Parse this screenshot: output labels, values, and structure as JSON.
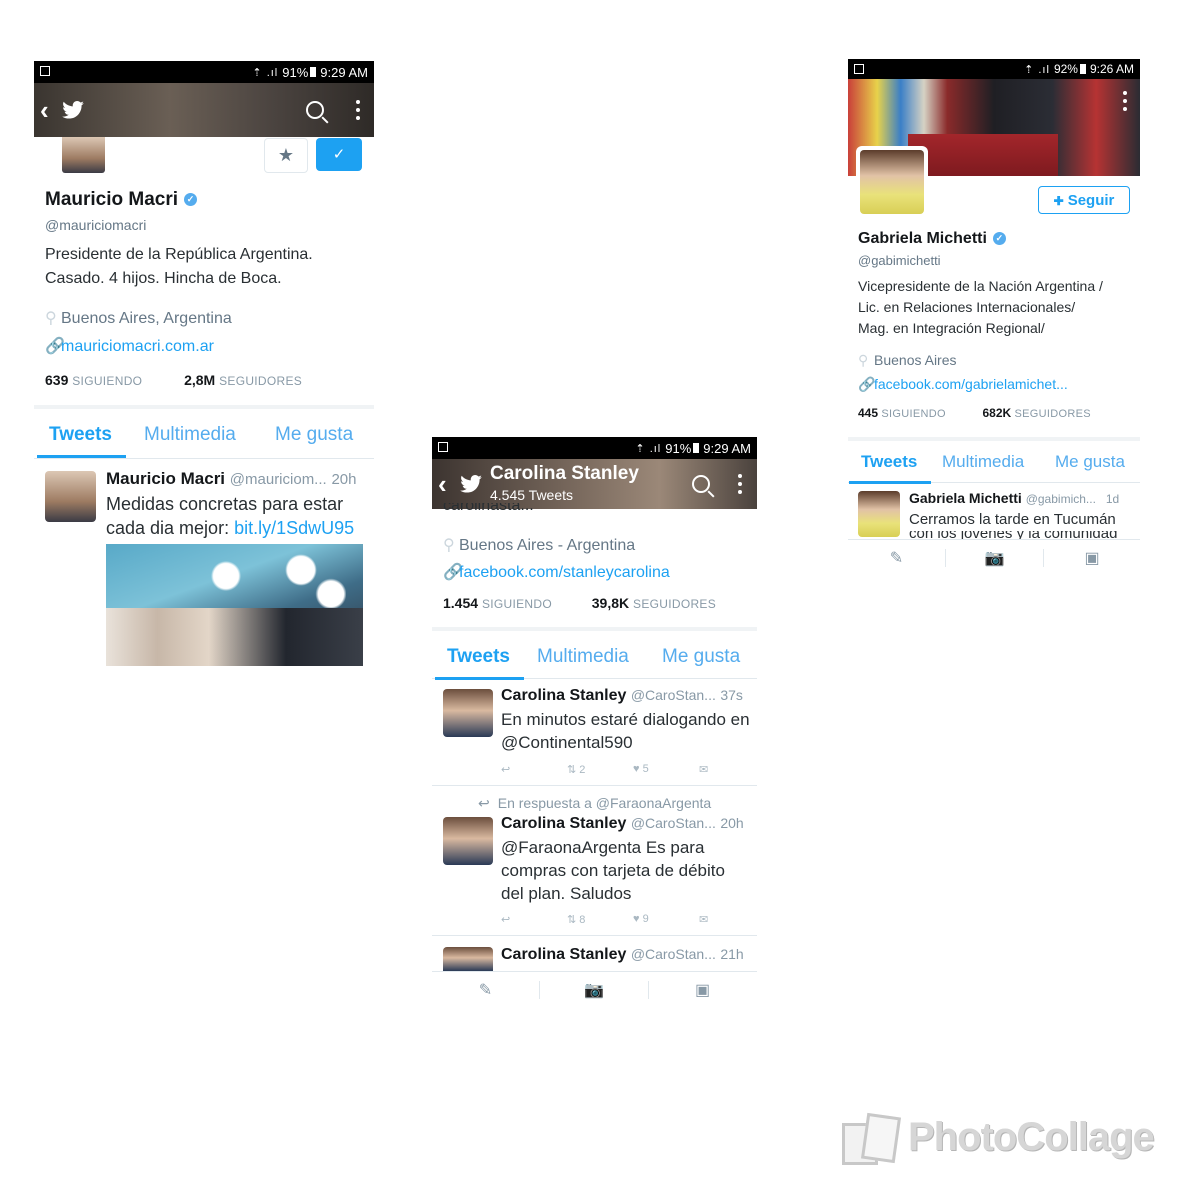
{
  "macri": {
    "status": {
      "signal": "91%",
      "time": "9:29 AM"
    },
    "profile": {
      "name": "Mauricio Macri",
      "handle": "@mauriciomacri",
      "bio_line1": "Presidente de la República Argentina.",
      "bio_line2": "Casado. 4 hijos. Hincha de Boca.",
      "location": "Buenos Aires, Argentina",
      "website": "mauriciomacri.com.ar",
      "following_count": "639",
      "following_label": "SIGUIENDO",
      "followers_count": "2,8M",
      "followers_label": "SEGUIDORES"
    },
    "tabs": [
      "Tweets",
      "Multimedia",
      "Me gusta"
    ],
    "tweet": {
      "name": "Mauricio Macri",
      "handle": "@mauriciom...",
      "time": "20h",
      "text": "Medidas concretas para estar cada dia mejor:",
      "link": "bit.ly/1SdwU95"
    }
  },
  "stanley": {
    "status": {
      "signal": "91%",
      "time": "9:29 AM"
    },
    "header": {
      "name": "Carolina Stanley",
      "tweet_count": "4.545 Tweets"
    },
    "profile": {
      "truncated": "carolinasta...",
      "location": "Buenos Aires - Argentina",
      "website": "facebook.com/stanleycarolina",
      "following_count": "1.454",
      "following_label": "SIGUIENDO",
      "followers_count": "39,8K",
      "followers_label": "SEGUIDORES"
    },
    "tabs": [
      "Tweets",
      "Multimedia",
      "Me gusta"
    ],
    "tweets": [
      {
        "name": "Carolina Stanley",
        "handle": "@CaroStan...",
        "time": "37s",
        "line1": "En minutos estaré dialogando en",
        "line2": "@Continental590",
        "line3": "",
        "retweets": "2",
        "likes": "5"
      },
      {
        "reply_to": "En respuesta a @FaraonaArgenta",
        "name": "Carolina Stanley",
        "handle": "@CaroStan...",
        "time": "20h",
        "line1": "@FaraonaArgenta Es para",
        "line2": "compras con tarjeta de débito",
        "line3": "del plan. Saludos",
        "retweets": "8",
        "likes": "9"
      },
      {
        "name": "Carolina Stanley",
        "handle": "@CaroStan...",
        "time": "21h"
      }
    ]
  },
  "michetti": {
    "status": {
      "signal": "92%",
      "time": "9:26 AM"
    },
    "follow_label": "Seguir",
    "profile": {
      "name": "Gabriela Michetti",
      "handle": "@gabimichetti",
      "bio_line1": "Vicepresidente de la Nación Argentina /",
      "bio_line2": "Lic. en Relaciones Internacionales/",
      "bio_line3": "Mag. en Integración Regional/",
      "location": "Buenos Aires",
      "website": "facebook.com/gabrielamichet...",
      "following_count": "445",
      "following_label": "SIGUIENDO",
      "followers_count": "682K",
      "followers_label": "SEGUIDORES"
    },
    "tabs": [
      "Tweets",
      "Multimedia",
      "Me gusta"
    ],
    "tweet": {
      "name": "Gabriela Michetti",
      "handle": "@gabimich...",
      "time": "1d",
      "text": "Cerramos la tarde en Tucumán",
      "text2": "con los jóvenes y la comunidad"
    }
  },
  "watermark": "PhotoCollage",
  "colors": {
    "twitter_blue": "#1da1f2",
    "light_blue": "#55acee"
  }
}
